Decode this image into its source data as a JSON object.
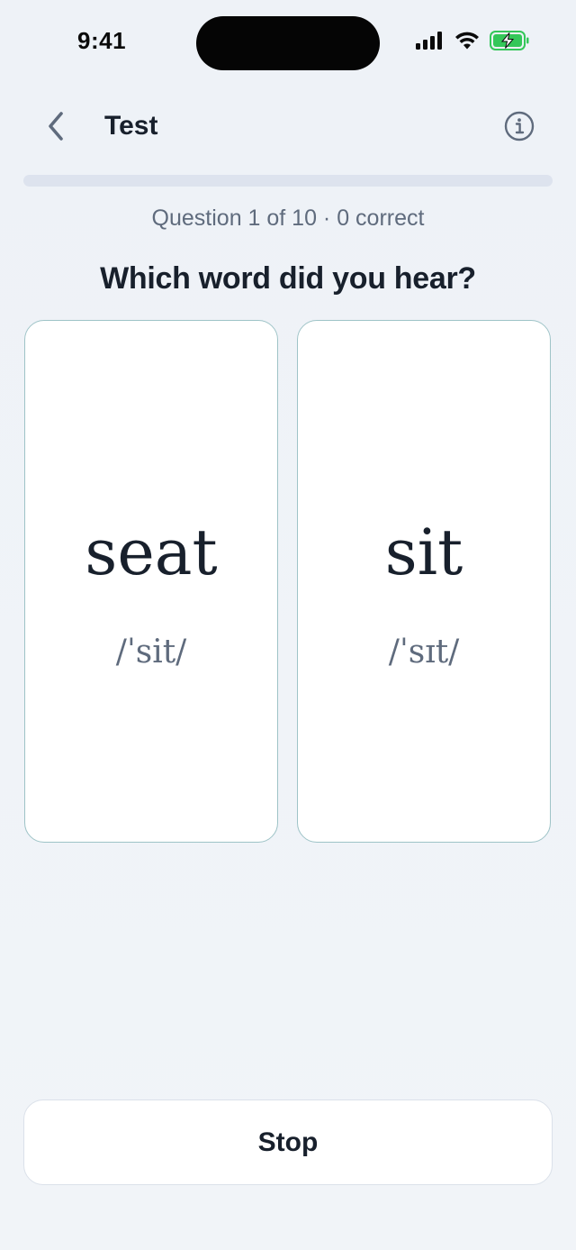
{
  "status_bar": {
    "time": "9:41",
    "icons": [
      "cellular-signal-icon",
      "wifi-icon",
      "battery-charging-icon"
    ],
    "battery_color": "#34c759"
  },
  "nav": {
    "back_icon": "chevron-left-icon",
    "title": "Test",
    "info_icon": "info-icon"
  },
  "progress": {
    "fraction": 0,
    "text": "Question 1 of 10 · 0 correct"
  },
  "prompt": "Which word did you hear?",
  "options": [
    {
      "word": "seat",
      "ipa": "/ˈsit/"
    },
    {
      "word": "sit",
      "ipa": "/ˈsɪt/"
    }
  ],
  "stop_label": "Stop",
  "colors": {
    "accent": "#7aa6ad",
    "card_border": "#9ec3c7",
    "text_primary": "#18202c",
    "text_secondary": "#5f6b7d"
  }
}
